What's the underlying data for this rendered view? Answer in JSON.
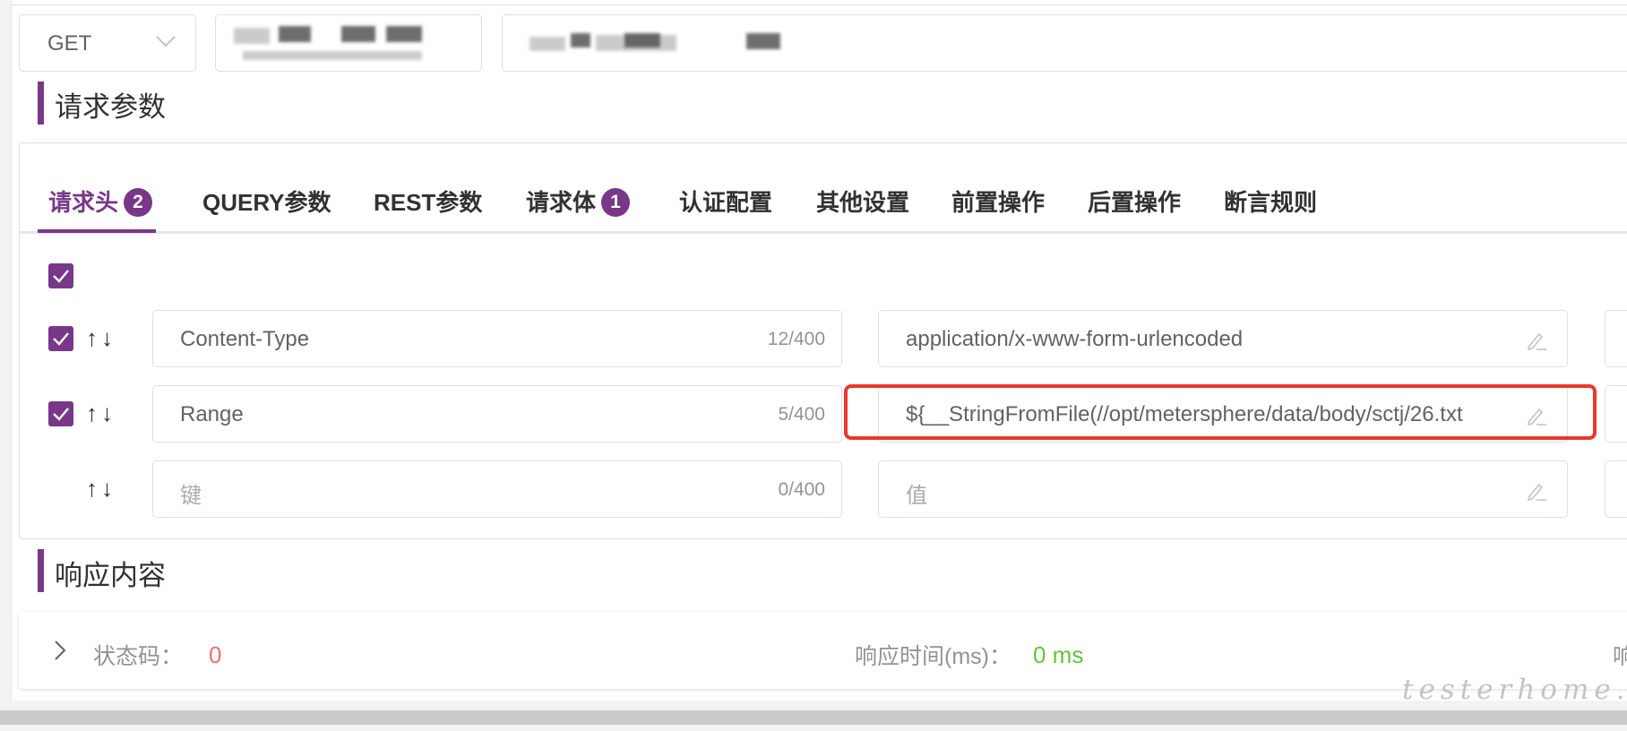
{
  "request": {
    "method": "GET"
  },
  "sections": {
    "params_title": "请求参数",
    "response_title": "响应内容"
  },
  "tabs": [
    {
      "label": "请求头",
      "badge": "2",
      "active": true
    },
    {
      "label": "QUERY参数"
    },
    {
      "label": "REST参数"
    },
    {
      "label": "请求体",
      "badge": "1"
    },
    {
      "label": "认证配置"
    },
    {
      "label": "其他设置"
    },
    {
      "label": "前置操作"
    },
    {
      "label": "后置操作"
    },
    {
      "label": "断言规则"
    }
  ],
  "headers": [
    {
      "enabled": true,
      "key": "Content-Type",
      "count": "12/400",
      "value": "application/x-www-form-urlencoded"
    },
    {
      "enabled": true,
      "key": "Range",
      "count": "5/400",
      "value": "${__StringFromFile(//opt/metersphere/data/body/sctj/26.txt"
    },
    {
      "enabled": false,
      "key_placeholder": "键",
      "count": "0/400",
      "value_placeholder": "值"
    }
  ],
  "arrows": "↑↓",
  "response": {
    "status_label": "状态码：",
    "status_value": "0",
    "time_label": "响应时间(ms)：",
    "time_value": "0 ms",
    "size_label_partial": "响"
  },
  "watermark": "testerhome.com",
  "colors": {
    "accent": "#783887",
    "highlight": "#e8392c",
    "status_error": "#f56c6c",
    "time_ok": "#67c23a"
  }
}
